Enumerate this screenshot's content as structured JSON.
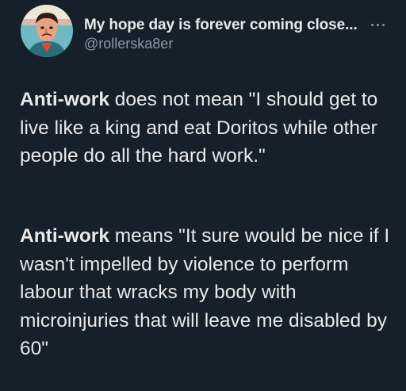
{
  "tweet": {
    "display_name": "My hope day is forever coming close...",
    "handle": "@rollerska8er",
    "more_icon": "more-horizontal-icon",
    "avatar_icon": "avatar-portrait",
    "paragraphs": [
      {
        "bold": "Anti-work",
        "text": " does not mean \"I should get to live like a king and eat Doritos while other people do all the hard work.\""
      },
      {
        "bold": "Anti-work",
        "text": " means \"It sure would be nice if I wasn't impelled by violence to perform labour that wracks my body with microinjuries that will leave me disabled by 60\""
      }
    ]
  },
  "colors": {
    "background": "#15202b",
    "text": "#e7e9ea",
    "secondary": "#8b98a5"
  }
}
